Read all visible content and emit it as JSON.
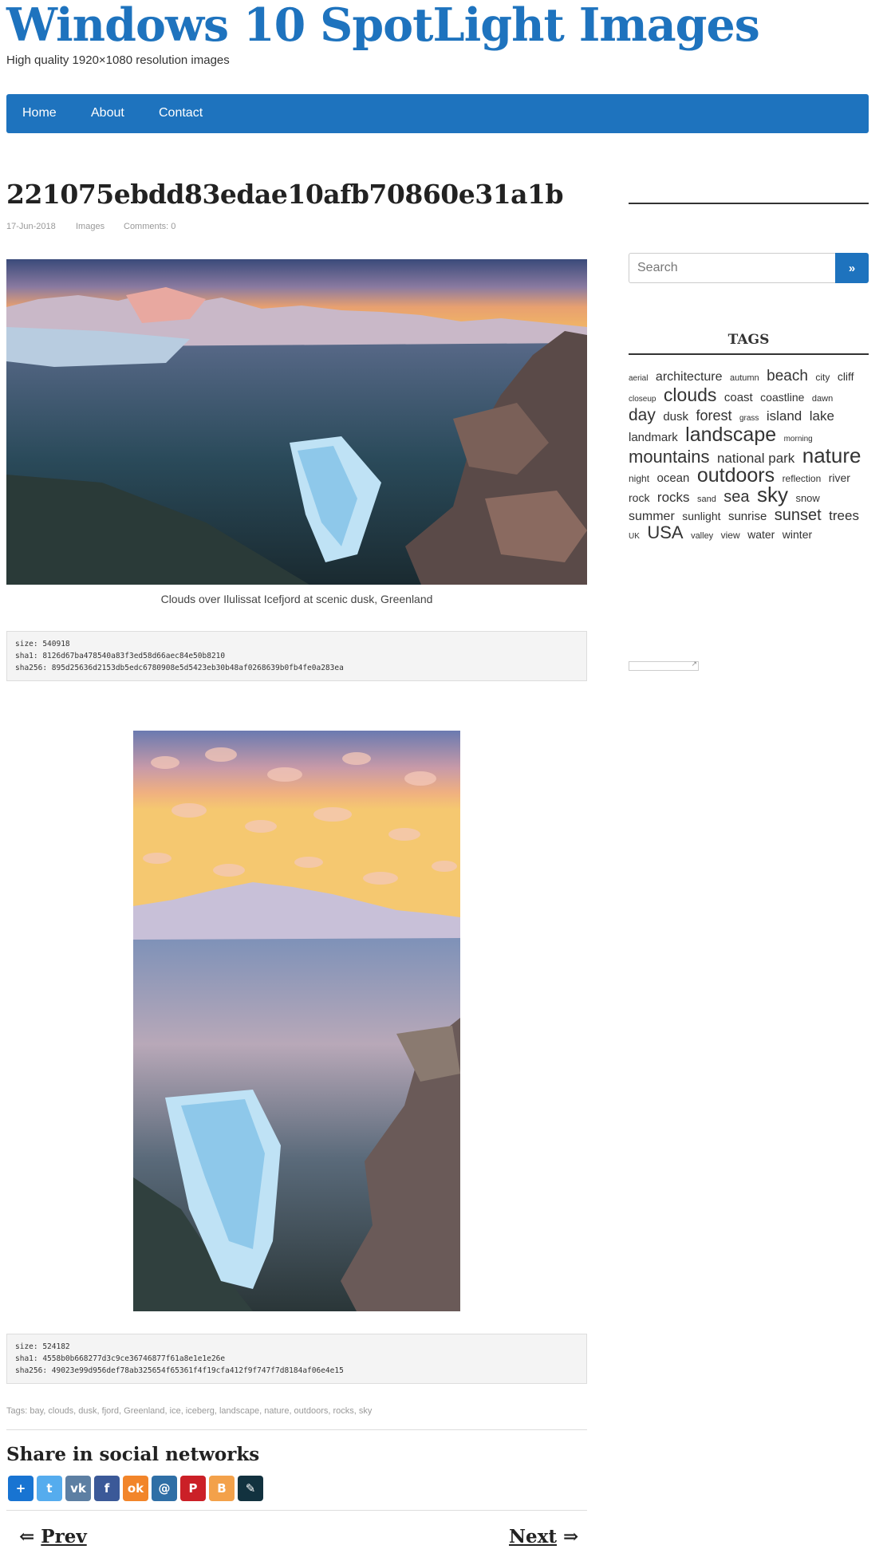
{
  "site": {
    "title": "Windows 10 SpotLight Images",
    "description": "High quality 1920×1080 resolution images"
  },
  "nav": {
    "items": [
      "Home",
      "About",
      "Contact"
    ]
  },
  "post": {
    "title": "221075ebdd83edae10afb70860e31a1b",
    "date": "17-Jun-2018",
    "category": "Images",
    "comments": "Comments: 0",
    "caption": "Clouds over Ilulissat Icefjord at scenic dusk, Greenland",
    "image1_alt": "Icefjord landscape at dusk",
    "image2_alt": "Icefjord landscape at dusk portrait",
    "code1": {
      "size": "size: 540918",
      "sha1": "sha1: 8126d67ba478540a83f3ed58d66aec84e50b8210",
      "sha256": "sha256: 895d25636d2153db5edc6780908e5d5423eb30b48af0268639b0fb4fe0a283ea"
    },
    "code2": {
      "size": "size: 524182",
      "sha1": "sha1: 4558b0b668277d3c9ce36746877f61a8e1e1e26e",
      "sha256": "sha256: 49023e99d956def78ab325654f65361f4f19cfa412f9f747f7d8184af06e4e15"
    },
    "tags_line": "Tags: bay, clouds, dusk, fjord, Greenland, ice, iceberg, landscape, nature, outdoors, rocks, sky"
  },
  "share": {
    "title": "Share in social networks",
    "buttons": [
      {
        "name": "addthis",
        "glyph": "+",
        "color": "#1874d2"
      },
      {
        "name": "twitter",
        "glyph": "t",
        "color": "#55acee"
      },
      {
        "name": "vk",
        "glyph": "vk",
        "color": "#5d7fa3"
      },
      {
        "name": "facebook",
        "glyph": "f",
        "color": "#3b5998"
      },
      {
        "name": "odnoklassniki",
        "glyph": "ok",
        "color": "#f2852a"
      },
      {
        "name": "mail",
        "glyph": "@",
        "color": "#2f6fa6"
      },
      {
        "name": "pinterest",
        "glyph": "P",
        "color": "#cb2027"
      },
      {
        "name": "blogger",
        "glyph": "B",
        "color": "#f3a14a"
      },
      {
        "name": "livejournal",
        "glyph": "✎",
        "color": "#12323f"
      }
    ]
  },
  "pager": {
    "prev": "Prev",
    "next": "Next",
    "prev_arrow": "⇐",
    "next_arrow": "⇒"
  },
  "sidebar": {
    "search_placeholder": "Search",
    "search_button": "»",
    "tags_heading": "TAGS",
    "tags": [
      {
        "t": "aerial",
        "s": 10
      },
      {
        "t": "architecture",
        "s": 16
      },
      {
        "t": "autumn",
        "s": 11
      },
      {
        "t": "beach",
        "s": 19
      },
      {
        "t": "city",
        "s": 12
      },
      {
        "t": "cliff",
        "s": 14
      },
      {
        "t": "closeup",
        "s": 10
      },
      {
        "t": "clouds",
        "s": 23
      },
      {
        "t": "coast",
        "s": 15
      },
      {
        "t": "coastline",
        "s": 14
      },
      {
        "t": "dawn",
        "s": 11
      },
      {
        "t": "day",
        "s": 21
      },
      {
        "t": "dusk",
        "s": 15
      },
      {
        "t": "forest",
        "s": 18
      },
      {
        "t": "grass",
        "s": 10
      },
      {
        "t": "island",
        "s": 17
      },
      {
        "t": "lake",
        "s": 17
      },
      {
        "t": "landmark",
        "s": 15
      },
      {
        "t": "landscape",
        "s": 25
      },
      {
        "t": "morning",
        "s": 10
      },
      {
        "t": "mountains",
        "s": 22
      },
      {
        "t": "national park",
        "s": 17
      },
      {
        "t": "nature",
        "s": 26
      },
      {
        "t": "night",
        "s": 12
      },
      {
        "t": "ocean",
        "s": 15
      },
      {
        "t": "outdoors",
        "s": 25
      },
      {
        "t": "reflection",
        "s": 12
      },
      {
        "t": "river",
        "s": 14
      },
      {
        "t": "rock",
        "s": 14
      },
      {
        "t": "rocks",
        "s": 17
      },
      {
        "t": "sand",
        "s": 11
      },
      {
        "t": "sea",
        "s": 20
      },
      {
        "t": "sky",
        "s": 26
      },
      {
        "t": "snow",
        "s": 13
      },
      {
        "t": "summer",
        "s": 16
      },
      {
        "t": "sunlight",
        "s": 14
      },
      {
        "t": "sunrise",
        "s": 15
      },
      {
        "t": "sunset",
        "s": 20
      },
      {
        "t": "trees",
        "s": 17
      },
      {
        "t": "UK",
        "s": 10
      },
      {
        "t": "USA",
        "s": 22
      },
      {
        "t": "valley",
        "s": 11
      },
      {
        "t": "view",
        "s": 12
      },
      {
        "t": "water",
        "s": 14
      },
      {
        "t": "winter",
        "s": 14
      }
    ]
  }
}
